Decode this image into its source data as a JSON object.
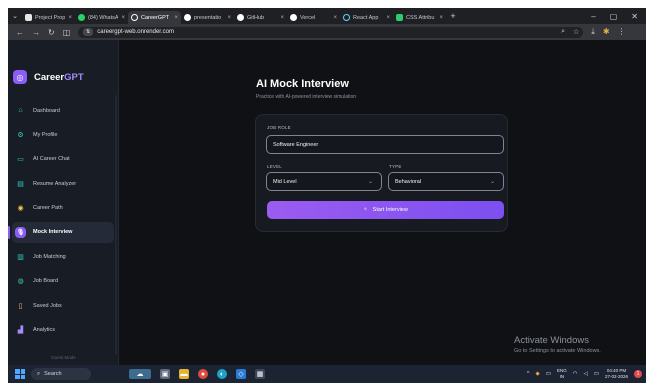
{
  "browser": {
    "tabs": [
      {
        "title": "Project Prop",
        "icon_color": "#f2f2f2"
      },
      {
        "title": "(84) WhatsAp",
        "icon_color": "#25d366"
      },
      {
        "title": "CareerGPT",
        "icon_color": "#ffffff",
        "active": true
      },
      {
        "title": "presentatio",
        "icon_color": "#ffffff"
      },
      {
        "title": "GitHub",
        "icon_color": "#ffffff"
      },
      {
        "title": "Vercel",
        "icon_color": "#ffffff"
      },
      {
        "title": "React App",
        "icon_color": "#61dafb"
      },
      {
        "title": "CSS Attribu",
        "icon_color": "#2ecc71"
      }
    ],
    "url": "careergpt-web.onrender.com"
  },
  "sidebar": {
    "brand": {
      "prefix": "Career",
      "suffix": "GPT"
    },
    "items": [
      {
        "label": "Dashboard",
        "icon": "home-icon"
      },
      {
        "label": "My Profile",
        "icon": "gear-icon"
      },
      {
        "label": "AI Career Chat",
        "icon": "chat-icon"
      },
      {
        "label": "Resume Analyzer",
        "icon": "document-icon"
      },
      {
        "label": "Career Path",
        "icon": "compass-icon"
      },
      {
        "label": "Mock Interview",
        "icon": "microphone-icon",
        "active": true
      },
      {
        "label": "Job Matching",
        "icon": "building-icon"
      },
      {
        "label": "Job Board",
        "icon": "globe-icon"
      },
      {
        "label": "Saved Jobs",
        "icon": "bookmark-icon"
      },
      {
        "label": "Analytics",
        "icon": "bar-chart-icon"
      }
    ],
    "footer": "Guest Mode"
  },
  "main": {
    "title": "AI Mock Interview",
    "subtitle": "Practice with AI-powered interview simulation",
    "form": {
      "job_role_label": "JOB ROLE",
      "job_role_value": "Software Engineer",
      "level_label": "LEVEL",
      "level_value": "Mid Level",
      "type_label": "TYPE",
      "type_value": "Behavioral",
      "start_label": "Start Interview"
    }
  },
  "watermark": {
    "title": "Activate Windows",
    "subtitle": "Go to Settings to activate Windows."
  },
  "taskbar": {
    "search": "Search",
    "lang_top": "ENG",
    "lang_bottom": "IN",
    "time": "04:40 PM",
    "date": "27-02-2026",
    "notifications": "1"
  },
  "colors": {
    "accent": "#8b5cf6",
    "icon_teal": "#2dd4bf"
  }
}
